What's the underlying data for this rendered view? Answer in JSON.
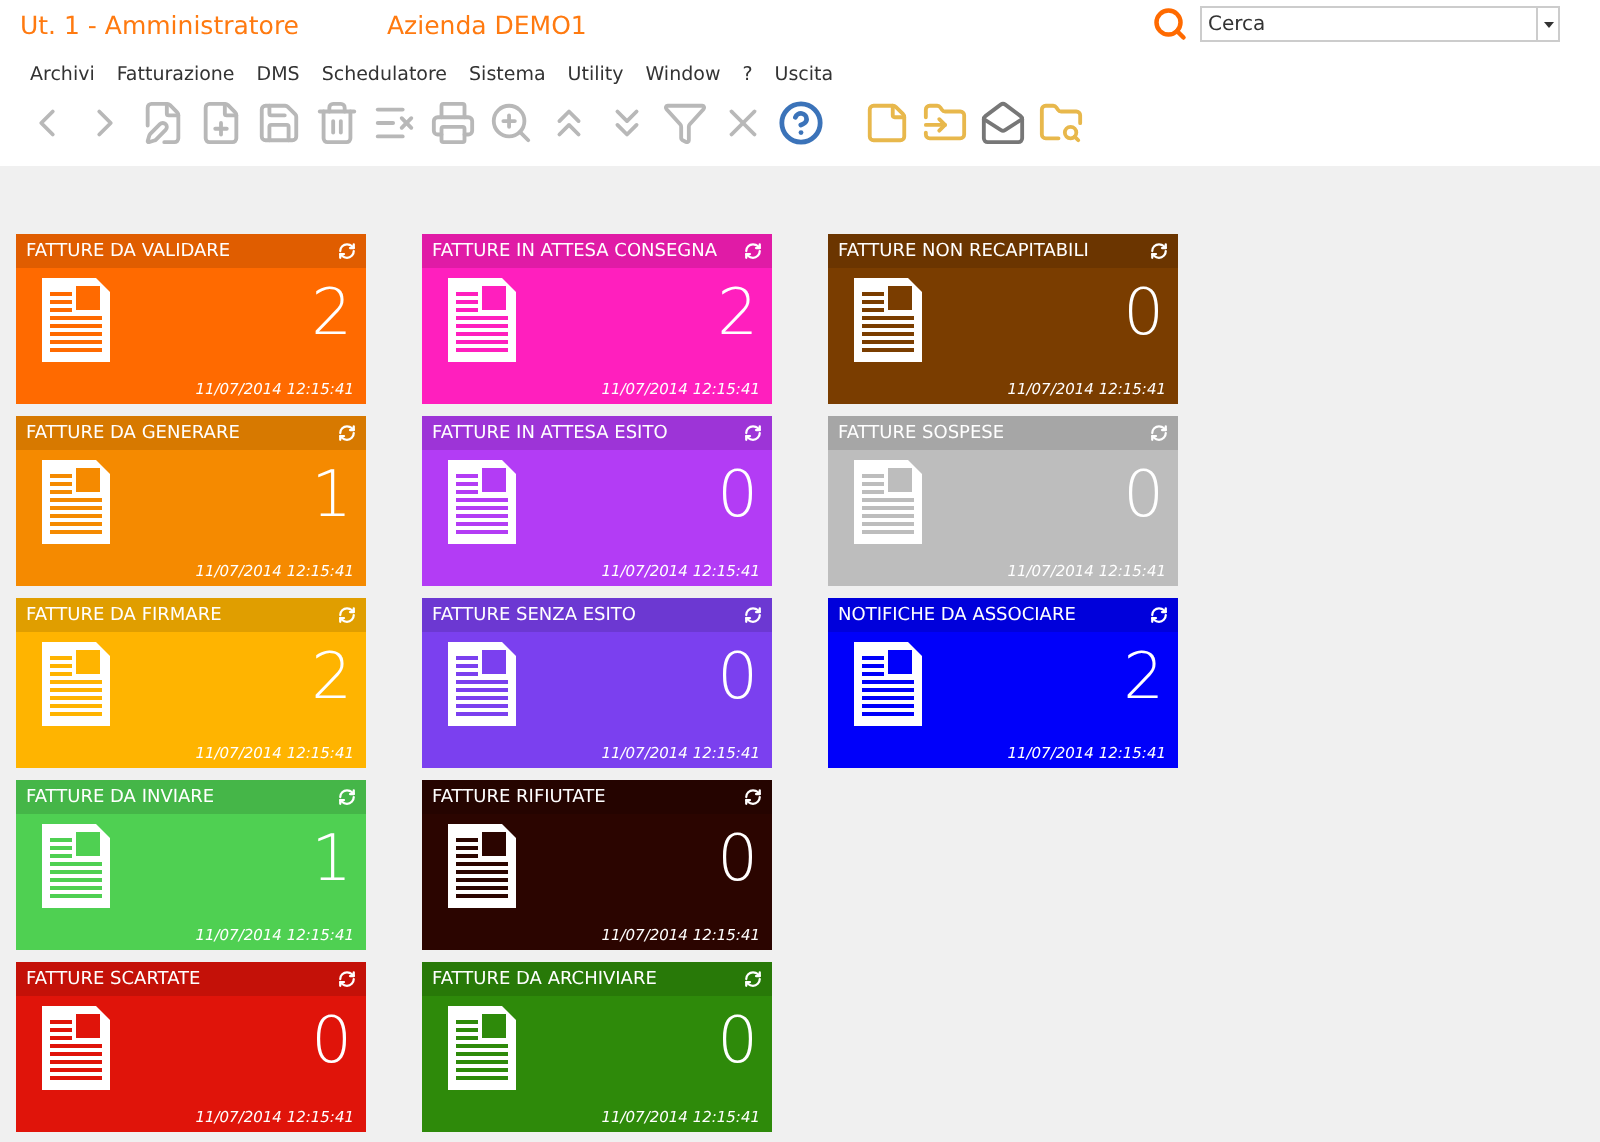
{
  "header": {
    "user": "Ut. 1 - Amministratore",
    "company": "Azienda DEMO1",
    "search": {
      "value": "Cerca"
    }
  },
  "menu": [
    "Archivi",
    "Fatturazione",
    "DMS",
    "Schedulatore",
    "Sistema",
    "Utility",
    "Window",
    "?",
    "Uscita"
  ],
  "toolbar": [
    {
      "kind": "back",
      "disabled": true
    },
    {
      "kind": "forward",
      "disabled": true
    },
    {
      "kind": "edit",
      "disabled": true
    },
    {
      "kind": "new",
      "disabled": true
    },
    {
      "kind": "save",
      "disabled": true
    },
    {
      "kind": "delete",
      "disabled": true
    },
    {
      "kind": "remove",
      "disabled": true
    },
    {
      "kind": "print",
      "disabled": true
    },
    {
      "kind": "zoom",
      "disabled": true
    },
    {
      "kind": "up",
      "disabled": true
    },
    {
      "kind": "down",
      "disabled": true
    },
    {
      "kind": "filter",
      "disabled": true
    },
    {
      "kind": "cancel",
      "disabled": true
    },
    {
      "kind": "help",
      "disabled": false
    },
    {
      "kind": "note",
      "disabled": false
    },
    {
      "kind": "folder",
      "disabled": false
    },
    {
      "kind": "mail",
      "disabled": false
    },
    {
      "kind": "folder-search",
      "disabled": false
    }
  ],
  "columns": [
    [
      {
        "title": "FATTURE DA VALIDARE",
        "count": "2",
        "timestamp": "11/07/2014 12:15:41",
        "color": "#ff6a00"
      },
      {
        "title": "FATTURE DA GENERARE",
        "count": "1",
        "timestamp": "11/07/2014 12:15:41",
        "color": "#f58a00"
      },
      {
        "title": "FATTURE DA FIRMARE",
        "count": "2",
        "timestamp": "11/07/2014 12:15:41",
        "color": "#ffb400"
      },
      {
        "title": "FATTURE DA INVIARE",
        "count": "1",
        "timestamp": "11/07/2014 12:15:41",
        "color": "#4fd052"
      },
      {
        "title": "FATTURE SCARTATE",
        "count": "0",
        "timestamp": "11/07/2014 12:15:41",
        "color": "#e0140a"
      }
    ],
    [
      {
        "title": "FATTURE IN ATTESA CONSEGNA",
        "count": "2",
        "timestamp": "11/07/2014 12:15:41",
        "color": "#ff1fbe"
      },
      {
        "title": "FATTURE IN ATTESA ESITO",
        "count": "0",
        "timestamp": "11/07/2014 12:15:41",
        "color": "#b33cf5"
      },
      {
        "title": "FATTURE SENZA ESITO",
        "count": "0",
        "timestamp": "11/07/2014 12:15:41",
        "color": "#7b40ef"
      },
      {
        "title": "FATTURE RIFIUTATE",
        "count": "0",
        "timestamp": "11/07/2014 12:15:41",
        "color": "#2b0500"
      },
      {
        "title": "FATTURE DA ARCHIVIARE",
        "count": "0",
        "timestamp": "11/07/2014 12:15:41",
        "color": "#2e8a0a"
      }
    ],
    [
      {
        "title": "FATTURE NON RECAPITABILI",
        "count": "0",
        "timestamp": "11/07/2014 12:15:41",
        "color": "#7a3d00"
      },
      {
        "title": "FATTURE SOSPESE",
        "count": "0",
        "timestamp": "11/07/2014 12:15:41",
        "color": "#bdbdbd"
      },
      {
        "title": "NOTIFICHE DA ASSOCIARE",
        "count": "2",
        "timestamp": "11/07/2014 12:15:41",
        "color": "#0000fa"
      }
    ]
  ]
}
